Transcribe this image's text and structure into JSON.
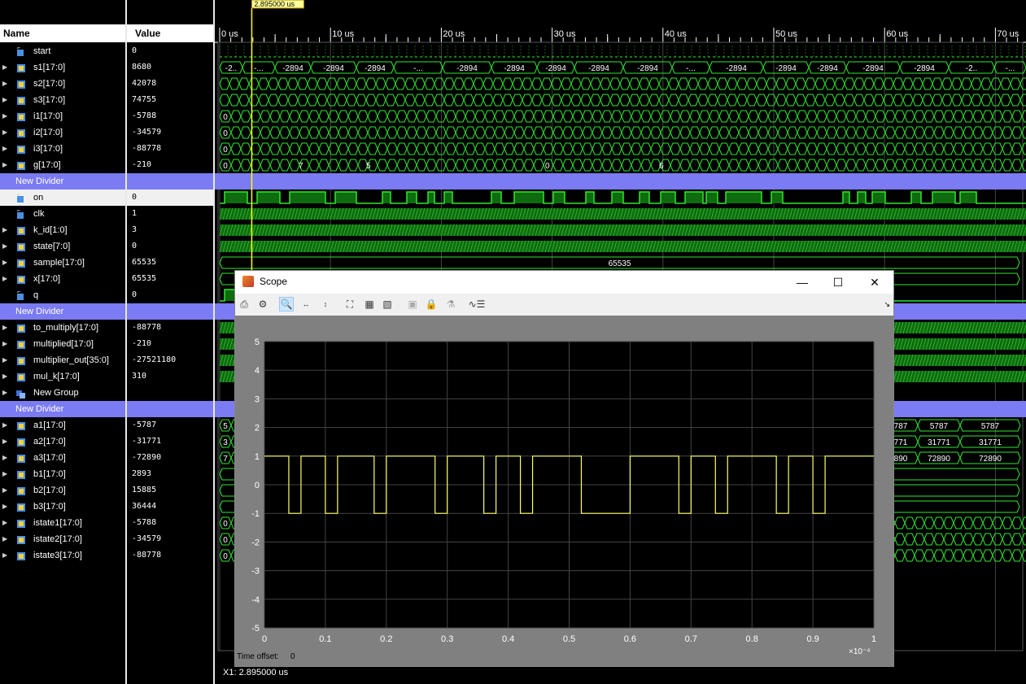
{
  "cursor_time": "2.895000 us",
  "headers": {
    "name": "Name",
    "value": "Value"
  },
  "time_ticks": [
    "0 us",
    "10 us",
    "20 us",
    "30 us",
    "40 us",
    "50 us",
    "60 us",
    "70 us"
  ],
  "signals": [
    {
      "name": "start",
      "value": "0",
      "kind": "bit",
      "expand": false
    },
    {
      "name": "s1[17:0]",
      "value": "8680",
      "kind": "bus",
      "expand": true,
      "labels": [
        "-2..",
        "-...",
        "-2894",
        "-2894",
        "-2894",
        "-...",
        "-2894",
        "-2894",
        "-2894",
        "-2894",
        "-2894",
        "-...",
        "-2894",
        "-2894",
        "-2894",
        "-2894",
        "-2894"
      ]
    },
    {
      "name": "s2[17:0]",
      "value": "42078",
      "kind": "bus",
      "expand": true
    },
    {
      "name": "s3[17:0]",
      "value": "74755",
      "kind": "bus",
      "expand": true
    },
    {
      "name": "i1[17:0]",
      "value": "-5788",
      "kind": "bus",
      "expand": true,
      "labels": [
        "0"
      ]
    },
    {
      "name": "i2[17:0]",
      "value": "-34579",
      "kind": "bus",
      "expand": true,
      "labels": [
        "0"
      ]
    },
    {
      "name": "i3[17:0]",
      "value": "-88778",
      "kind": "bus",
      "expand": true,
      "labels": [
        "0"
      ]
    },
    {
      "name": "g[17:0]",
      "value": "-210",
      "kind": "bus",
      "expand": true,
      "labels": [
        "0",
        "7",
        "5",
        "0",
        "6"
      ]
    },
    {
      "name": "New Divider",
      "value": "",
      "kind": "divider"
    },
    {
      "name": "on",
      "value": "0",
      "kind": "bit",
      "expand": false,
      "selected": true
    },
    {
      "name": "clk",
      "value": "1",
      "kind": "bit",
      "expand": false
    },
    {
      "name": "k_id[1:0]",
      "value": "3",
      "kind": "bus",
      "expand": true
    },
    {
      "name": "state[7:0]",
      "value": "0",
      "kind": "bus",
      "expand": true
    },
    {
      "name": "sample[17:0]",
      "value": "65535",
      "kind": "bus",
      "expand": true,
      "labels": [
        "65535"
      ]
    },
    {
      "name": "x[17:0]",
      "value": "65535",
      "kind": "bus",
      "expand": true
    },
    {
      "name": "q",
      "value": "0",
      "kind": "bit",
      "expand": false
    },
    {
      "name": "New Divider",
      "value": "",
      "kind": "divider"
    },
    {
      "name": "to_multiply[17:0]",
      "value": "-88778",
      "kind": "bus",
      "expand": true
    },
    {
      "name": "multiplied[17:0]",
      "value": "-210",
      "kind": "bus",
      "expand": true
    },
    {
      "name": "multiplier_out[35:0]",
      "value": "-27521180",
      "kind": "bus",
      "expand": true
    },
    {
      "name": "mul_k[17:0]",
      "value": "310",
      "kind": "bus",
      "expand": true
    },
    {
      "name": "New Group",
      "value": "",
      "kind": "group",
      "expand": true
    },
    {
      "name": "New Divider",
      "value": "",
      "kind": "divider"
    },
    {
      "name": "a1[17:0]",
      "value": "-5787",
      "kind": "bus",
      "expand": true,
      "labels": [
        "5",
        "787",
        "5787",
        "5787"
      ]
    },
    {
      "name": "a2[17:0]",
      "value": "-31771",
      "kind": "bus",
      "expand": true,
      "labels": [
        "3",
        "771",
        "31771",
        "31771"
      ]
    },
    {
      "name": "a3[17:0]",
      "value": "-72890",
      "kind": "bus",
      "expand": true,
      "labels": [
        "7",
        "890",
        "72890",
        "72890"
      ]
    },
    {
      "name": "b1[17:0]",
      "value": "2893",
      "kind": "bus",
      "expand": true
    },
    {
      "name": "b2[17:0]",
      "value": "15885",
      "kind": "bus",
      "expand": true
    },
    {
      "name": "b3[17:0]",
      "value": "36444",
      "kind": "bus",
      "expand": true
    },
    {
      "name": "istate1[17:0]",
      "value": "-5788",
      "kind": "bus",
      "expand": true,
      "labels": [
        "0"
      ]
    },
    {
      "name": "istate2[17:0]",
      "value": "-34579",
      "kind": "bus",
      "expand": true,
      "labels": [
        "0"
      ]
    },
    {
      "name": "istate3[17:0]",
      "value": "-88778",
      "kind": "bus",
      "expand": true,
      "labels": [
        "0"
      ]
    }
  ],
  "status": "X1: 2.895000 us",
  "scope": {
    "title": "Scope",
    "time_offset_label": "Time offset:",
    "time_offset_value": "0",
    "x_exponent": "×10⁻⁴",
    "chart_data": {
      "type": "line",
      "xlim": [
        0,
        1
      ],
      "ylim": [
        -5,
        5
      ],
      "xticks": [
        "0",
        "0.1",
        "0.2",
        "0.3",
        "0.4",
        "0.5",
        "0.6",
        "0.7",
        "0.8",
        "0.9",
        "1"
      ],
      "yticks": [
        "5",
        "4",
        "3",
        "2",
        "1",
        "0",
        "-1",
        "-2",
        "-3",
        "-4",
        "-5"
      ],
      "grid": true,
      "x_scale_label": "×10⁻⁴",
      "series": [
        {
          "color": "#ffff66",
          "x": [
            0,
            0.04,
            0.04,
            0.06,
            0.06,
            0.1,
            0.1,
            0.12,
            0.12,
            0.18,
            0.18,
            0.2,
            0.2,
            0.28,
            0.28,
            0.3,
            0.3,
            0.36,
            0.36,
            0.38,
            0.38,
            0.42,
            0.42,
            0.44,
            0.44,
            0.52,
            0.52,
            0.6,
            0.6,
            0.68,
            0.68,
            0.7,
            0.7,
            0.74,
            0.74,
            0.76,
            0.76,
            0.84,
            0.84,
            0.86,
            0.86,
            0.9,
            0.9,
            0.92,
            0.92,
            1
          ],
          "y": [
            1,
            1,
            -1,
            -1,
            1,
            1,
            -1,
            -1,
            1,
            1,
            -1,
            -1,
            1,
            1,
            -1,
            -1,
            1,
            1,
            -1,
            -1,
            1,
            1,
            -1,
            -1,
            1,
            1,
            -1,
            -1,
            1,
            1,
            -1,
            -1,
            1,
            1,
            -1,
            -1,
            1,
            1,
            -1,
            -1,
            1,
            1,
            -1,
            -1,
            1,
            1
          ]
        }
      ]
    }
  }
}
